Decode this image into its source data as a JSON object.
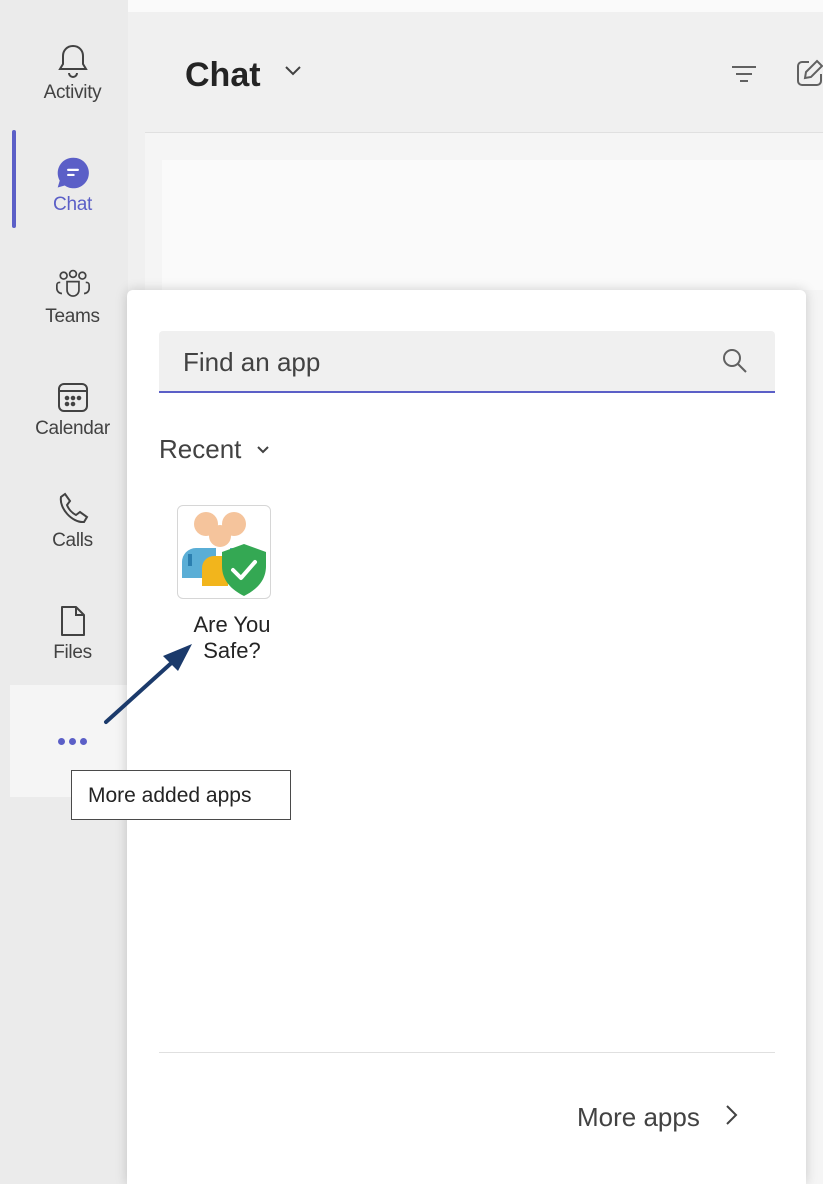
{
  "header": {
    "title": "Chat"
  },
  "rail": {
    "items": [
      {
        "label": "Activity",
        "icon": "bell-icon"
      },
      {
        "label": "Chat",
        "icon": "chat-icon",
        "active": true
      },
      {
        "label": "Teams",
        "icon": "teams-icon"
      },
      {
        "label": "Calendar",
        "icon": "calendar-icon"
      },
      {
        "label": "Calls",
        "icon": "phone-icon"
      },
      {
        "label": "Files",
        "icon": "file-icon"
      }
    ],
    "more_icon": "more-dots-icon"
  },
  "flyout": {
    "search": {
      "placeholder": "Find an app",
      "value": ""
    },
    "recent_label": "Recent",
    "apps": [
      {
        "name_line1": "Are You",
        "name_line2": "Safe?"
      }
    ],
    "more_apps_label": "More apps"
  },
  "tooltip": {
    "text": "More added apps"
  },
  "colors": {
    "accent": "#5b5fc7",
    "arrow": "#1b3a6b",
    "shield": "#34a853"
  }
}
